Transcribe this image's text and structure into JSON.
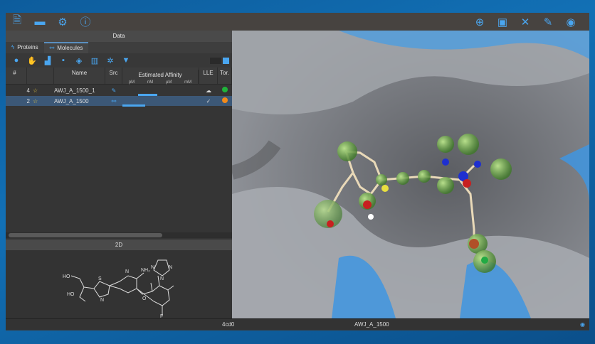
{
  "toolbar": {
    "left": [
      {
        "icon": "new-file-icon",
        "glyph": "🗎"
      },
      {
        "icon": "folder-open-icon",
        "glyph": "▬"
      },
      {
        "icon": "gear-icon",
        "glyph": "⚙"
      },
      {
        "icon": "info-icon",
        "glyph": "ⓘ"
      }
    ],
    "right": [
      {
        "icon": "target-icon",
        "glyph": "⊕"
      },
      {
        "icon": "monitor-icon",
        "glyph": "▣"
      },
      {
        "icon": "tools-icon",
        "glyph": "✕"
      },
      {
        "icon": "ruler-pencil-icon",
        "glyph": "✎"
      },
      {
        "icon": "eye-settings-icon",
        "glyph": "◉"
      }
    ]
  },
  "panel_title": "Data",
  "tabs": [
    {
      "label": "Proteins",
      "icon": "protein-icon",
      "glyph": "ϟ"
    },
    {
      "label": "Molecules",
      "icon": "molecule-icon",
      "glyph": "⚯"
    }
  ],
  "actions": [
    {
      "icon": "globe-icon",
      "glyph": "●"
    },
    {
      "icon": "hand-icon",
      "glyph": "✋"
    },
    {
      "icon": "bar-chart-icon",
      "glyph": "▟"
    },
    {
      "icon": "save-icon",
      "glyph": "▪"
    },
    {
      "icon": "eye-link-icon",
      "glyph": "◈"
    },
    {
      "icon": "trash-icon",
      "glyph": "▥"
    },
    {
      "icon": "network-icon",
      "glyph": "✲"
    },
    {
      "icon": "filter-icon",
      "glyph": "▼"
    }
  ],
  "table": {
    "headers": {
      "num": "#",
      "name": "Name",
      "src": "Src",
      "affinity": "Estimated Affinity",
      "units": [
        "pM",
        "nM",
        "µM",
        "mM"
      ],
      "lle": "LLE",
      "tor": "Tor."
    },
    "rows": [
      {
        "num": "4",
        "name": "AWJ_A_1500_1",
        "src": "✎",
        "lle": "☁",
        "tor_color": "#1fb33a",
        "bar_from": 0.2,
        "bar_to": 0.45,
        "selected": false
      },
      {
        "num": "2",
        "name": "AWJ_A_1500",
        "src": "⚯",
        "lle": "✓",
        "tor_color": "#f28a1a",
        "bar_from": 0.0,
        "bar_to": 0.3,
        "selected": true
      }
    ]
  },
  "section_2d": "2D",
  "molecule_labels": {
    "ho1": "HO",
    "ho2": "HO",
    "s": "S",
    "n1": "N",
    "n2": "N",
    "nh2": "NH₂",
    "o": "O",
    "f": "F",
    "n3": "N",
    "n4": "N",
    "n5": "N"
  },
  "status": {
    "protein": "4cd0",
    "ligand": "AWJ_A_1500"
  }
}
